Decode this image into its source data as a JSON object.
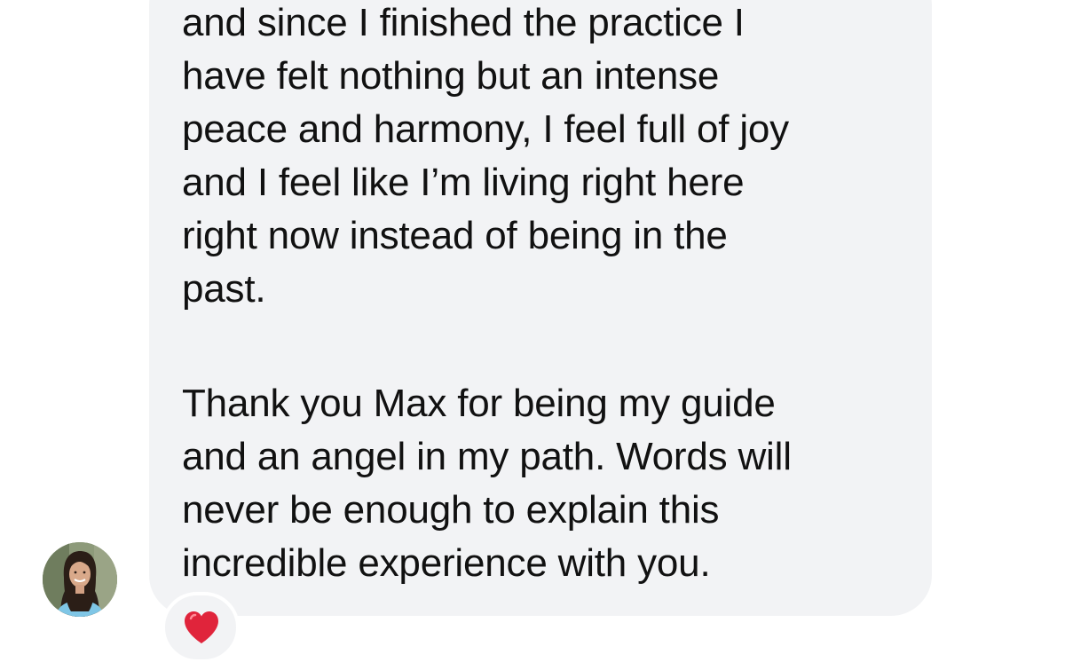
{
  "message": {
    "lines": [
      "and since I finished the practice I",
      "have felt nothing but an intense",
      "peace and harmony, I feel full of joy",
      "and I feel like I’m living right here",
      "right now instead of being in the",
      "past.",
      "Thank you Max for being my guide",
      "and an angel in my path. Words will",
      "never be enough to explain this",
      "incredible experience with you."
    ]
  },
  "sender": {
    "avatar_icon": "profile-photo"
  },
  "reaction": {
    "icon": "red-heart-icon",
    "color": "#e0243b"
  },
  "colors": {
    "bubble": "#f2f3f5",
    "text": "#111111"
  }
}
